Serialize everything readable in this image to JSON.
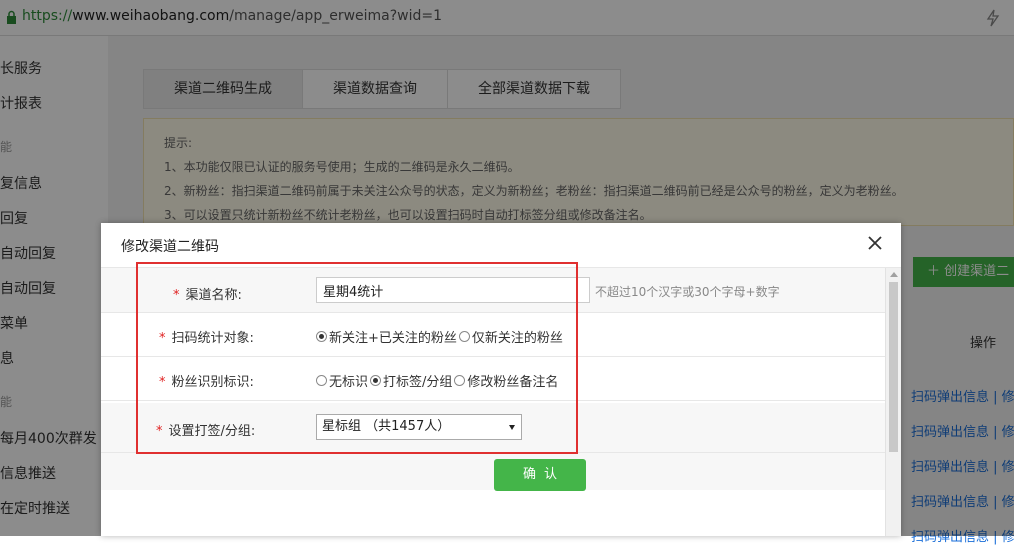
{
  "browser": {
    "url_scheme": "https://",
    "url_host": "www.weihaobang.com",
    "url_path": "/manage/app_erweima?wid=1"
  },
  "sidebar": {
    "items": [
      "长服务",
      "计报表",
      "能",
      "复信息",
      "回复",
      "自动回复",
      "自动回复",
      "菜单",
      "息",
      "能",
      "每月400次群发",
      "信息推送",
      "在定时推送"
    ]
  },
  "main": {
    "tabs": [
      "渠道二维码生成",
      "渠道数据查询",
      "全部渠道数据下载"
    ],
    "tips": {
      "title": "提示:",
      "lines": [
        "1、本功能仅限已认证的服务号使用；生成的二维码是永久二维码。",
        "2、新粉丝：指扫渠道二维码前属于未关注公众号的状态，定义为新粉丝；老粉丝：指扫渠道二维码前已经是公众号的粉丝，定义为老粉丝。",
        "3、可以设置只统计新粉丝不统计老粉丝，也可以设置扫码时自动打标签分组或修改备注名。"
      ]
    },
    "create_button": "创建渠道二",
    "table_op_header": "操作",
    "op_links": [
      "扫码弹出信息 | 修改",
      "扫码弹出信息 | 修改",
      "扫码弹出信息 | 修改",
      "扫码弹出信息 | 修改",
      "扫码弹出信息 | 修改"
    ]
  },
  "modal": {
    "title": "修改渠道二维码",
    "required_mark": "*",
    "channel_name": {
      "label": "渠道名称:",
      "value": "星期4统计",
      "hint": "不超过10个汉字或30个字母+数字"
    },
    "scan_target": {
      "label": "扫码统计对象:",
      "options": [
        {
          "label": "新关注+已关注的粉丝",
          "selected": true
        },
        {
          "label": "仅新关注的粉丝",
          "selected": false
        }
      ]
    },
    "fan_identity": {
      "label": "粉丝识别标识:",
      "options": [
        {
          "label": "无标识",
          "selected": false
        },
        {
          "label": "打标签/分组",
          "selected": true
        },
        {
          "label": "修改粉丝备注名",
          "selected": false
        }
      ]
    },
    "tag_group": {
      "label": "设置打签/分组:",
      "selected": "星标组 （共1457人）"
    },
    "confirm_button": "确认"
  },
  "colors": {
    "accent_green": "#44b549",
    "required_red": "#e02020",
    "highlight_red": "#e03030",
    "link_blue": "#1a6ed8"
  }
}
